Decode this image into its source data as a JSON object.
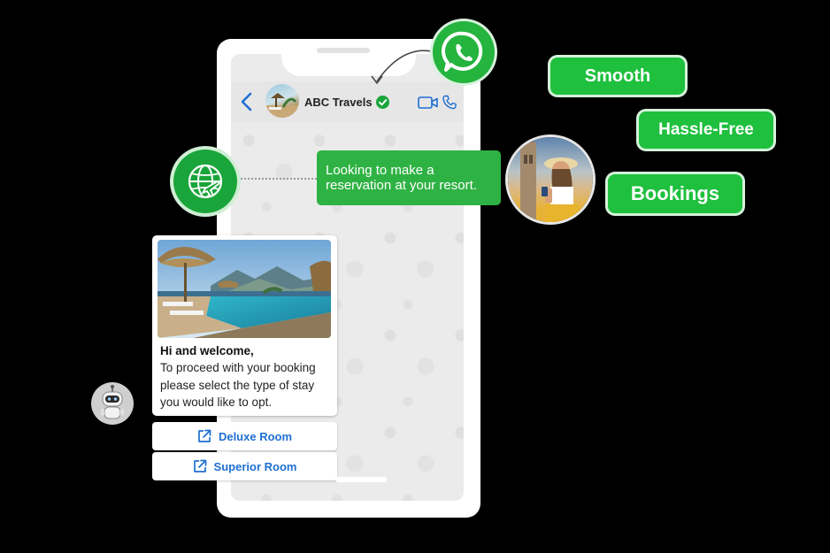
{
  "chat": {
    "contact_name": "ABC Travels",
    "user_message": "Looking to make a reservation at your resort.",
    "bot_message": {
      "heading": "Hi and welcome,",
      "lines": [
        "To proceed with your booking",
        "please select the type of stay",
        "you would like to opt."
      ]
    },
    "buttons": [
      {
        "label": "Deluxe Room",
        "icon": "external-link-icon"
      },
      {
        "label": "Superior Room",
        "icon": "external-link-icon"
      }
    ]
  },
  "tags": [
    "Smooth",
    "Hassle-Free",
    "Bookings"
  ],
  "icons": {
    "header": [
      "back-chevron-icon",
      "verified-check-icon",
      "video-call-icon",
      "phone-call-icon"
    ],
    "floating": [
      "whatsapp-icon",
      "globe-plane-icon",
      "robot-icon"
    ]
  },
  "colors": {
    "brand_green": "#25b43e",
    "bubble_green": "#2fb244",
    "pill_green": "#1ec03d",
    "link_blue": "#1f6fd1",
    "background": "#000000"
  }
}
